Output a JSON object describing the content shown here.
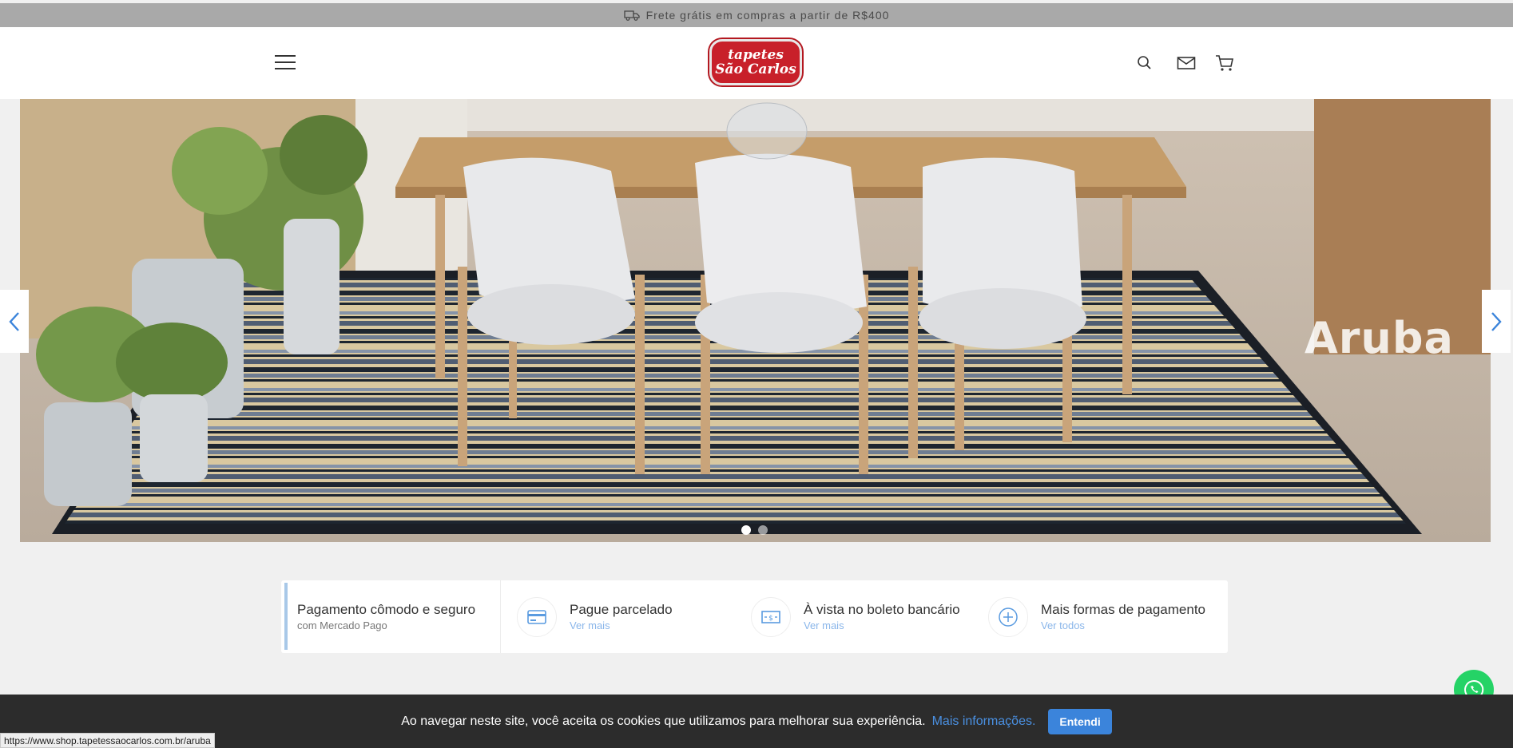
{
  "promo": {
    "text": "Frete grátis em compras a partir de R$400",
    "icon": "truck-icon"
  },
  "header": {
    "logo": {
      "line1": "tapetes",
      "line2": "São Carlos"
    },
    "icons": [
      "menu-icon",
      "search-icon",
      "mail-icon",
      "cart-icon"
    ]
  },
  "hero": {
    "caption": "Aruba",
    "slides": 2,
    "active_slide": 1
  },
  "payments": {
    "items": [
      {
        "title": "Pagamento cômodo e seguro",
        "sub": "com Mercado Pago"
      },
      {
        "title": "Pague parcelado",
        "link": "Ver mais",
        "icon": "credit-card-icon"
      },
      {
        "title": "À vista no boleto bancário",
        "link": "Ver mais",
        "icon": "cash-icon"
      },
      {
        "title": "Mais formas de pagamento",
        "link": "Ver todos",
        "icon": "plus-circle-icon"
      }
    ]
  },
  "cookie": {
    "text": "Ao navegar neste site, você aceita os cookies que utilizamos para melhorar sua experiência.",
    "more": "Mais informações.",
    "accept": "Entendi"
  },
  "status_url": "https://www.shop.tapetessaocarlos.com.br/aruba",
  "colors": {
    "brand_red": "#c8202a",
    "link_blue": "#4a90e2",
    "button_blue": "#3b84db",
    "whatsapp_green": "#25d366"
  }
}
